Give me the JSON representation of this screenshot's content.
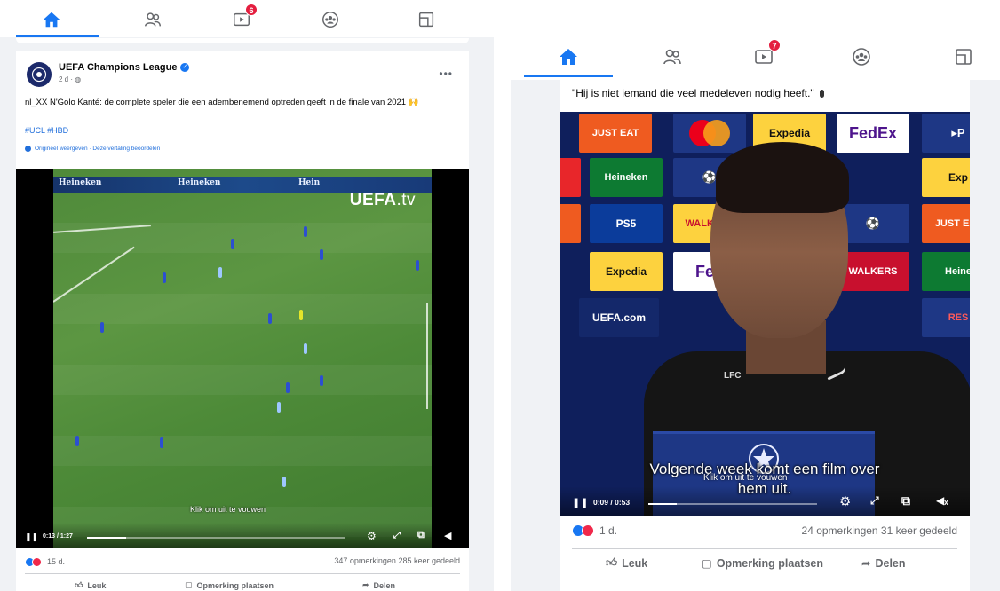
{
  "colors": {
    "accent": "#1877f2",
    "badge": "#e41e3f",
    "link": "#216fdb",
    "muted": "#65676b",
    "like_blue": "#1877f2",
    "love_red": "#f0284a"
  },
  "left": {
    "nav": {
      "items": [
        {
          "icon": "home-icon",
          "active": true
        },
        {
          "icon": "friends-icon"
        },
        {
          "icon": "watch-icon",
          "badge": "6"
        },
        {
          "icon": "groups-icon"
        },
        {
          "icon": "gaming-icon"
        }
      ]
    },
    "post": {
      "page_name": "UEFA Champions League",
      "meta": "2 d · ",
      "caption": "nl_XX N'Golo Kanté: de complete speler die een adembenemend optreden geeft in de finale van 2021 🙌",
      "hashtags": "#UCL #HBD",
      "translation_link": "Origineel weergeven · Deze vertaling beoordelen",
      "video": {
        "watermark_main": "UEFA",
        "watermark_suffix": ".tv",
        "ad_boards": [
          "Heineken",
          "Heineken",
          "Hein"
        ],
        "overlay_text": "Klik om uit te vouwen",
        "time": "0:13 / 1:27",
        "progress": 0.15
      },
      "reaction_count": "15 d.",
      "stats": "347 opmerkingen  285 keer gedeeld",
      "actions": {
        "like": "Leuk",
        "comment": "Opmerking plaatsen",
        "share": "Delen"
      }
    }
  },
  "right": {
    "nav": {
      "items": [
        {
          "icon": "home-icon",
          "active": true
        },
        {
          "icon": "friends-icon"
        },
        {
          "icon": "watch-icon",
          "badge": "7"
        },
        {
          "icon": "groups-icon"
        },
        {
          "icon": "gaming-icon"
        }
      ]
    },
    "post": {
      "quote": "\"Hij is niet iemand die veel medeleven nodig heeft.\"",
      "video": {
        "sponsor_tiles": [
          "JUST EAT",
          "Expedia",
          "FedEx",
          "Heineken",
          "Exp",
          "PS5",
          "WALKERS",
          "JUST EAT",
          "Expedia",
          "Fed",
          "WALKERS",
          "Heine",
          "UEFA.com",
          "RES"
        ],
        "subtitle_line1": "Volgende week komt een film over",
        "subtitle_line2": "hem uit.",
        "overlay_text": "Klik om uit te vouwen",
        "time": "0:09 / 0:53",
        "progress": 0.17
      },
      "reaction_count": "1 d.",
      "stats": "24 opmerkingen  31 keer gedeeld",
      "actions": {
        "like": "Leuk",
        "comment": "Opmerking plaatsen",
        "share": "Delen"
      }
    }
  }
}
